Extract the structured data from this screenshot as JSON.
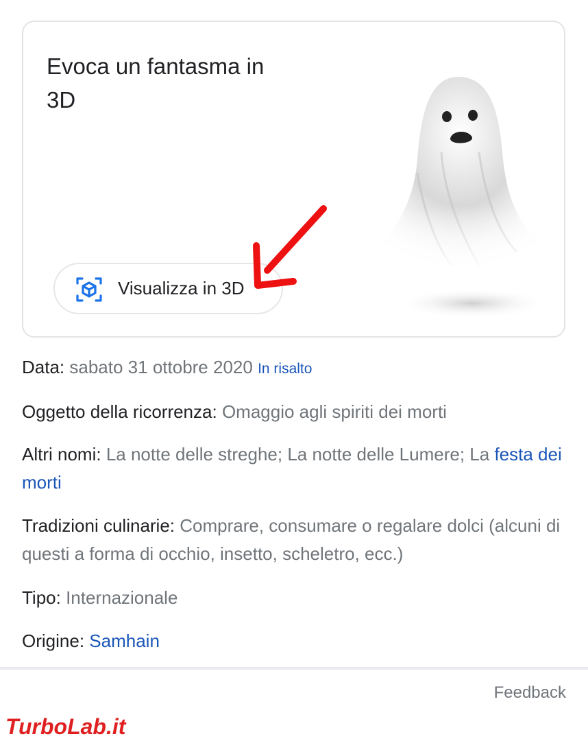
{
  "card": {
    "title": "Evoca un fantasma in 3D",
    "button_label": "Visualizza in 3D",
    "button_icon": "3d-cube-icon",
    "accent_color": "#1a73e8"
  },
  "facts": {
    "date": {
      "label": "Data:",
      "value": "sabato 31 ottobre 2020",
      "tag": "In risalto"
    },
    "occasion": {
      "label": "Oggetto della ricorrenza:",
      "value": "Omaggio agli spiriti dei morti"
    },
    "other_names": {
      "label": "Altri nomi:",
      "value": "La notte delle streghe; La notte delle Lumere; La",
      "link": "festa dei morti"
    },
    "food": {
      "label": "Tradizioni culinarie:",
      "value": "Comprare, consumare o regalare dolci (alcuni di questi a forma di occhio, insetto, scheletro, ecc.)"
    },
    "type": {
      "label": "Tipo:",
      "value": "Internazionale"
    },
    "origin": {
      "label": "Origine:",
      "link": "Samhain"
    }
  },
  "footer": {
    "feedback": "Feedback"
  },
  "watermark": {
    "text": "TurboLab.it"
  }
}
